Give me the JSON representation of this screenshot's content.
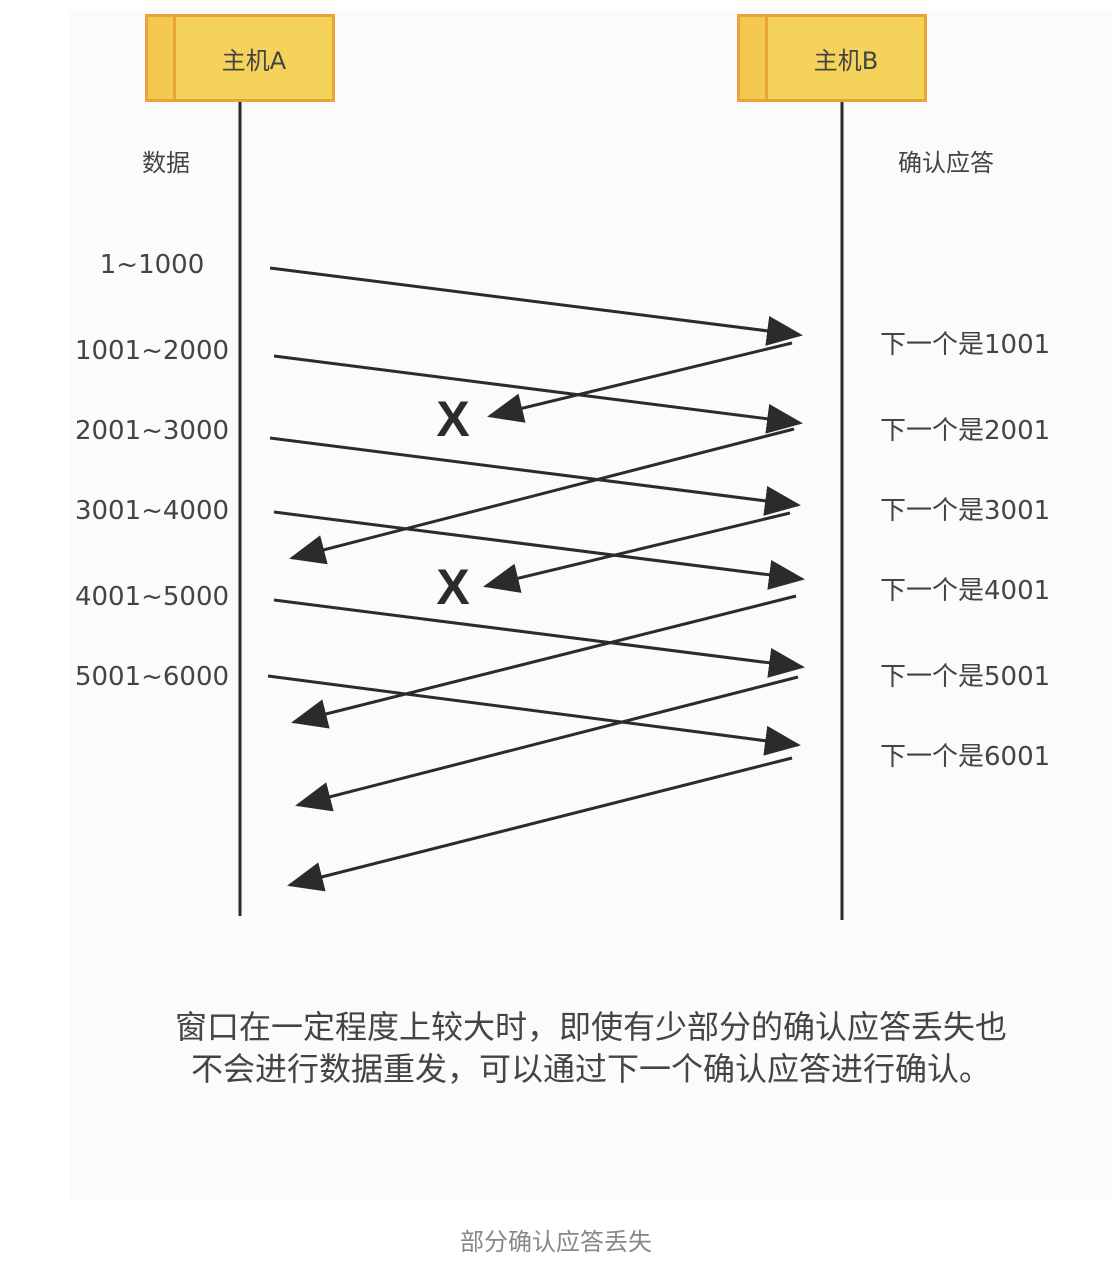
{
  "hosts": {
    "a": "主机A",
    "b": "主机B"
  },
  "columns": {
    "left": "数据",
    "right": "确认应答"
  },
  "segments": [
    "1~1000",
    "1001~2000",
    "2001~3000",
    "3001~4000",
    "4001~5000",
    "5001~6000"
  ],
  "acks": [
    "下一个是1001",
    "下一个是2001",
    "下一个是3001",
    "下一个是4001",
    "下一个是5001",
    "下一个是6001"
  ],
  "lost_ack_mark": "X",
  "lost_acks": [
    "下一个是1001",
    "下一个是3001"
  ],
  "caption": {
    "line1": "窗口在一定程度上较大时，即使有少部分的确认应答丢失也",
    "line2": "不会进行数据重发，可以通过下一个确认应答进行确认。"
  },
  "figure_caption": "部分确认应答丢失",
  "colors": {
    "host_fill": "#f5d35b",
    "host_border": "#e8a33a",
    "line": "#2b2b2b"
  }
}
